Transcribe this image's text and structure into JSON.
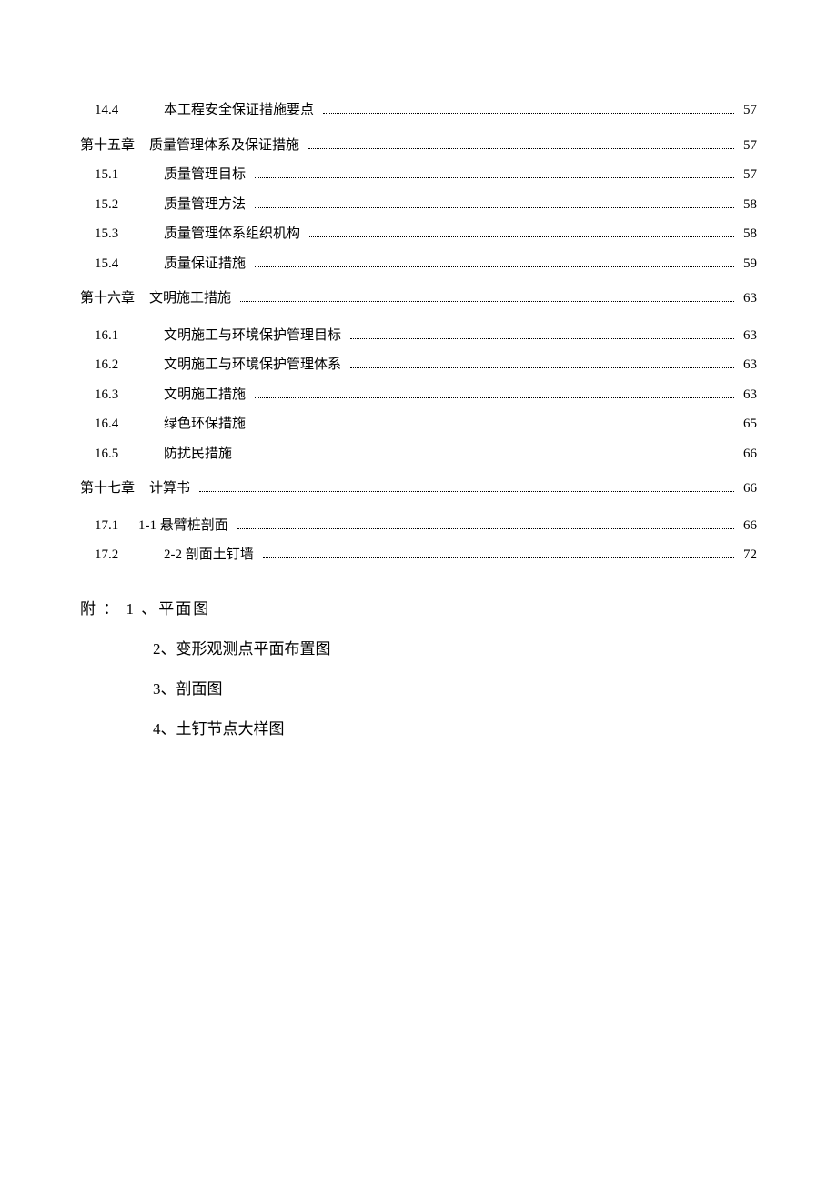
{
  "toc": {
    "sec14_4": {
      "num": "14.4",
      "title": "本工程安全保证措施要点",
      "page": "57"
    },
    "chap15": {
      "num": "第十五章",
      "title": "质量管理体系及保证措施",
      "page": "57"
    },
    "sec15_1": {
      "num": "15.1",
      "title": "质量管理目标",
      "page": "57"
    },
    "sec15_2": {
      "num": "15.2",
      "title": "质量管理方法",
      "page": "58"
    },
    "sec15_3": {
      "num": "15.3",
      "title": "质量管理体系组织机构",
      "page": "58"
    },
    "sec15_4": {
      "num": "15.4",
      "title": "质量保证措施",
      "page": "59"
    },
    "chap16": {
      "num": "第十六章",
      "title": "文明施工措施",
      "page": "63"
    },
    "sec16_1": {
      "num": "16.1",
      "title": "文明施工与环境保护管理目标",
      "page": "63"
    },
    "sec16_2": {
      "num": "16.2",
      "title": "文明施工与环境保护管理体系",
      "page": "63"
    },
    "sec16_3": {
      "num": "16.3",
      "title": "文明施工措施",
      "page": "63"
    },
    "sec16_4": {
      "num": "16.4",
      "title": "绿色环保措施",
      "page": "65"
    },
    "sec16_5": {
      "num": "16.5",
      "title": "防扰民措施",
      "page": "66"
    },
    "chap17": {
      "num": "第十七章",
      "title": "计算书",
      "page": "66"
    },
    "sec17_1": {
      "num": "17.1",
      "title": "1-1 悬臂桩剖面",
      "page": "66"
    },
    "sec17_2": {
      "num": "17.2",
      "title": "2-2 剖面土钉墙",
      "page": "72"
    }
  },
  "attachments": {
    "heading": "附 ： 1 、平面图",
    "items": {
      "a2": "2、变形观测点平面布置图",
      "a3": "3、剖面图",
      "a4": "4、土钉节点大样图"
    }
  }
}
